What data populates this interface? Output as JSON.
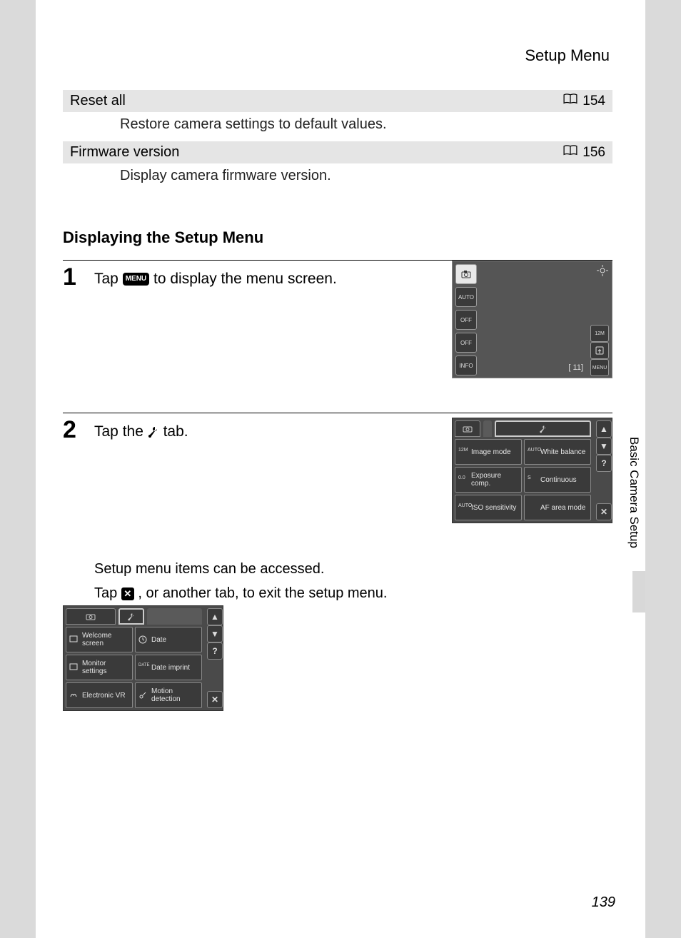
{
  "header": {
    "title": "Setup Menu"
  },
  "settings": [
    {
      "name": "Reset all",
      "page_ref": "154",
      "desc": "Restore camera settings to default values."
    },
    {
      "name": "Firmware version",
      "page_ref": "156",
      "desc": "Display camera firmware version."
    }
  ],
  "section_heading": "Displaying the Setup Menu",
  "steps": {
    "step1": {
      "num": "1",
      "text_before": "Tap ",
      "badge": "MENU",
      "text_after": " to display the menu screen."
    },
    "step2": {
      "num": "2",
      "text_before": "Tap the ",
      "text_after": " tab.",
      "extra_line1": "Setup menu items can be accessed.",
      "extra_line2a": "Tap ",
      "extra_line2b": ", or another tab, to exit the setup menu."
    }
  },
  "camera_screen1": {
    "left_icons": [
      "",
      "AUTO",
      "OFF",
      "OFF",
      "INFO"
    ],
    "right_top": "",
    "bottom_text": "[    11]",
    "menu_label": "MENU"
  },
  "menu_screen1": {
    "items": [
      [
        "Image mode",
        "White balance"
      ],
      [
        "Exposure comp.",
        "Continuous"
      ],
      [
        "ISO sensitivity",
        "AF area mode"
      ]
    ],
    "item_icons": [
      [
        "12M",
        "AUTO"
      ],
      [
        "0.0",
        "S"
      ],
      [
        "AUTO",
        ""
      ]
    ],
    "side": [
      "▲",
      "▼",
      "?",
      "✕"
    ]
  },
  "menu_screen2": {
    "items": [
      [
        "Welcome screen",
        "Date"
      ],
      [
        "Monitor settings",
        "Date imprint"
      ],
      [
        "Electronic VR",
        "Motion detection"
      ]
    ],
    "side": [
      "▲",
      "▼",
      "?",
      "✕"
    ]
  },
  "side_tab": "Basic Camera Setup",
  "page_number": "139"
}
